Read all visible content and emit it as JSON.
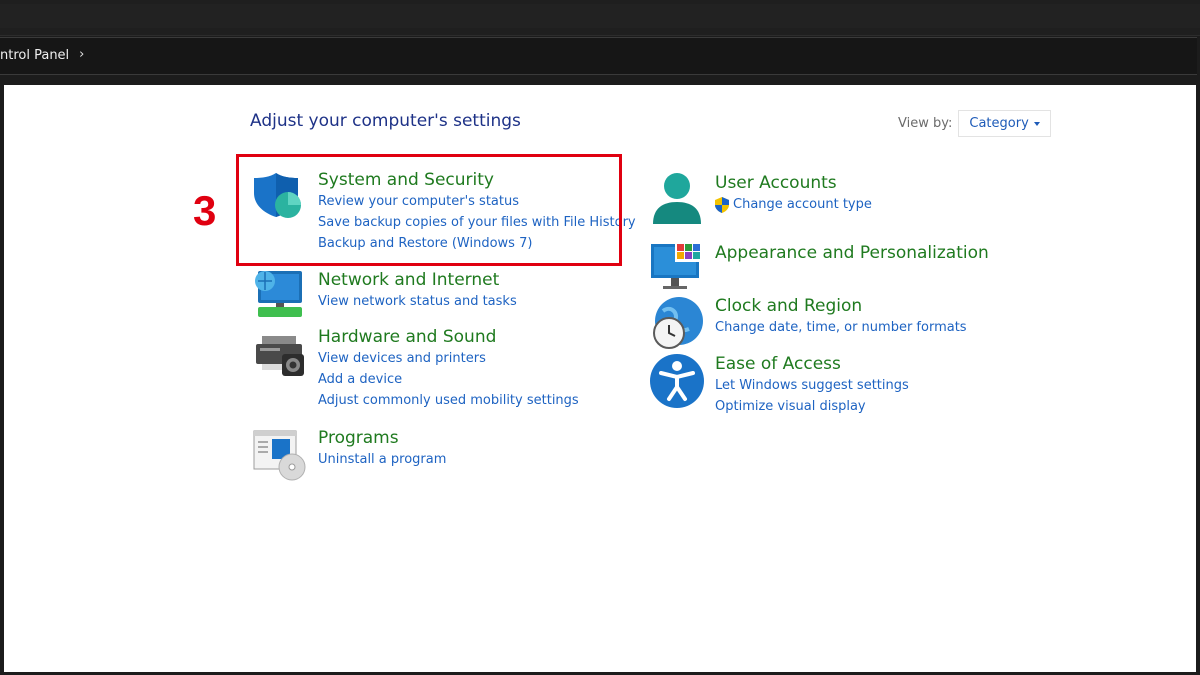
{
  "breadcrumb": {
    "text": "ntrol Panel",
    "separator": "›"
  },
  "page_title": "Adjust your computer's settings",
  "view_by": {
    "label": "View by:",
    "value": "Category"
  },
  "annotation": {
    "step": "3"
  },
  "categories_left": [
    {
      "title": "System and Security",
      "icon": "shield-icon",
      "links": [
        "Review your computer's status",
        "Save backup copies of your files with File History",
        "Backup and Restore (Windows 7)"
      ]
    },
    {
      "title": "Network and Internet",
      "icon": "network-icon",
      "links": [
        "View network status and tasks"
      ]
    },
    {
      "title": "Hardware and Sound",
      "icon": "printer-icon",
      "links": [
        "View devices and printers",
        "Add a device",
        "Adjust commonly used mobility settings"
      ]
    },
    {
      "title": "Programs",
      "icon": "programs-icon",
      "links": [
        "Uninstall a program"
      ]
    }
  ],
  "categories_right": [
    {
      "title": "User Accounts",
      "icon": "user-icon",
      "links": [
        "Change account type"
      ]
    },
    {
      "title": "Appearance and Personalization",
      "icon": "monitor-icon",
      "links": []
    },
    {
      "title": "Clock and Region",
      "icon": "clock-icon",
      "links": [
        "Change date, time, or number formats"
      ]
    },
    {
      "title": "Ease of Access",
      "icon": "accessibility-icon",
      "links": [
        "Let Windows suggest settings",
        "Optimize visual display"
      ]
    }
  ],
  "colors": {
    "title_green": "#1f7a1f",
    "link_blue": "#1e63c2",
    "highlight_red": "#e00010"
  }
}
